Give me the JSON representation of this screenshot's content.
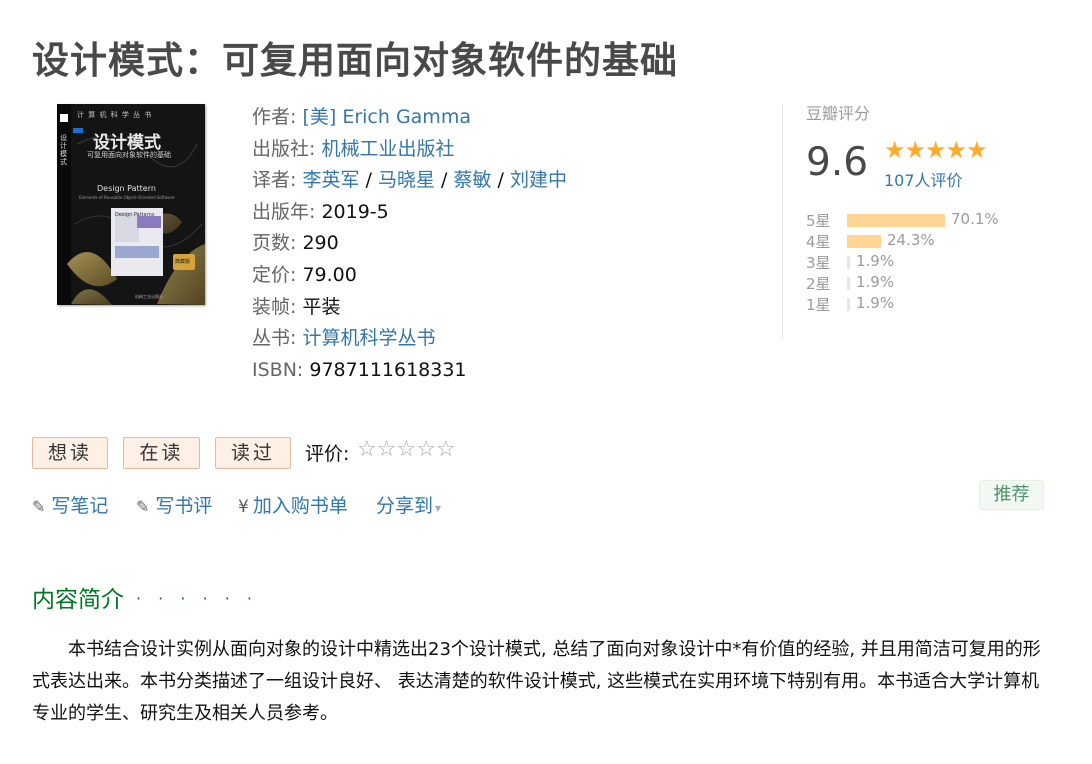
{
  "book": {
    "title": "设计模式：可复用面向对象软件的基础",
    "cover": {
      "series": "计 算 机 科 学 丛 书",
      "title_cn": "设计模式",
      "subtitle_cn": "可复用面向对象软件的基础",
      "title_en": "Design Pattern",
      "subtitle_en": "Elements of Reusable Object-Oriented Software",
      "inner_title": "Design Patterns",
      "badge": "典藏版",
      "spine_title": "设计模式",
      "publisher_mark": "机械工业出版社"
    }
  },
  "info": {
    "author_label": "作者:",
    "author_value": "[美] Erich Gamma",
    "publisher_label": "出版社:",
    "publisher_value": "机械工业出版社",
    "translator_label": "译者:",
    "translators": [
      "李英军",
      "马晓星",
      "蔡敏",
      "刘建中"
    ],
    "translator_sep": "/",
    "pubyear_label": "出版年:",
    "pubyear_value": "2019-5",
    "pages_label": "页数:",
    "pages_value": "290",
    "price_label": "定价:",
    "price_value": "79.00",
    "binding_label": "装帧:",
    "binding_value": "平装",
    "series_label": "丛书:",
    "series_value": "计算机科学丛书",
    "isbn_label": "ISBN:",
    "isbn_value": "9787111618331"
  },
  "rating": {
    "label": "豆瓣评分",
    "score": "9.6",
    "stars": "★★★★★",
    "people": "107人评价",
    "star_value": 5,
    "distribution": [
      {
        "label": "5星",
        "percent": "70.1%",
        "value": 70.1
      },
      {
        "label": "4星",
        "percent": "24.3%",
        "value": 24.3
      },
      {
        "label": "3星",
        "percent": "1.9%",
        "value": 1.9
      },
      {
        "label": "2星",
        "percent": "1.9%",
        "value": 1.9
      },
      {
        "label": "1星",
        "percent": "1.9%",
        "value": 1.9
      }
    ]
  },
  "actions": {
    "want": "想读",
    "reading": "在读",
    "read": "读过",
    "rate_label": "评价:",
    "rate_stars": [
      "☆",
      "☆",
      "☆",
      "☆",
      "☆"
    ]
  },
  "links": {
    "note": "写笔记",
    "review": "写书评",
    "cart": "加入购书单",
    "share": "分享到",
    "pencil_icon": "✎",
    "yen_icon": "¥",
    "caret_icon": "▾"
  },
  "recommend": "推荐",
  "intro": {
    "heading": "内容简介",
    "dots": "· · · · · ·",
    "text": "本书结合设计实例从面向对象的设计中精选出23个设计模式, 总结了面向对象设计中*有价值的经验, 并且用简洁可复用的形式表达出来。本书分类描述了一组设计良好、 表达清楚的软件设计模式, 这些模式在实用环境下特别有用。本书适合大学计算机专业的学生、研究生及相关人员参考。"
  },
  "colors": {
    "link": "#3377aa",
    "star": "#ffac2d",
    "bar": "#ffd596",
    "section_green": "#007722",
    "button_bg": "#fff0e6"
  }
}
